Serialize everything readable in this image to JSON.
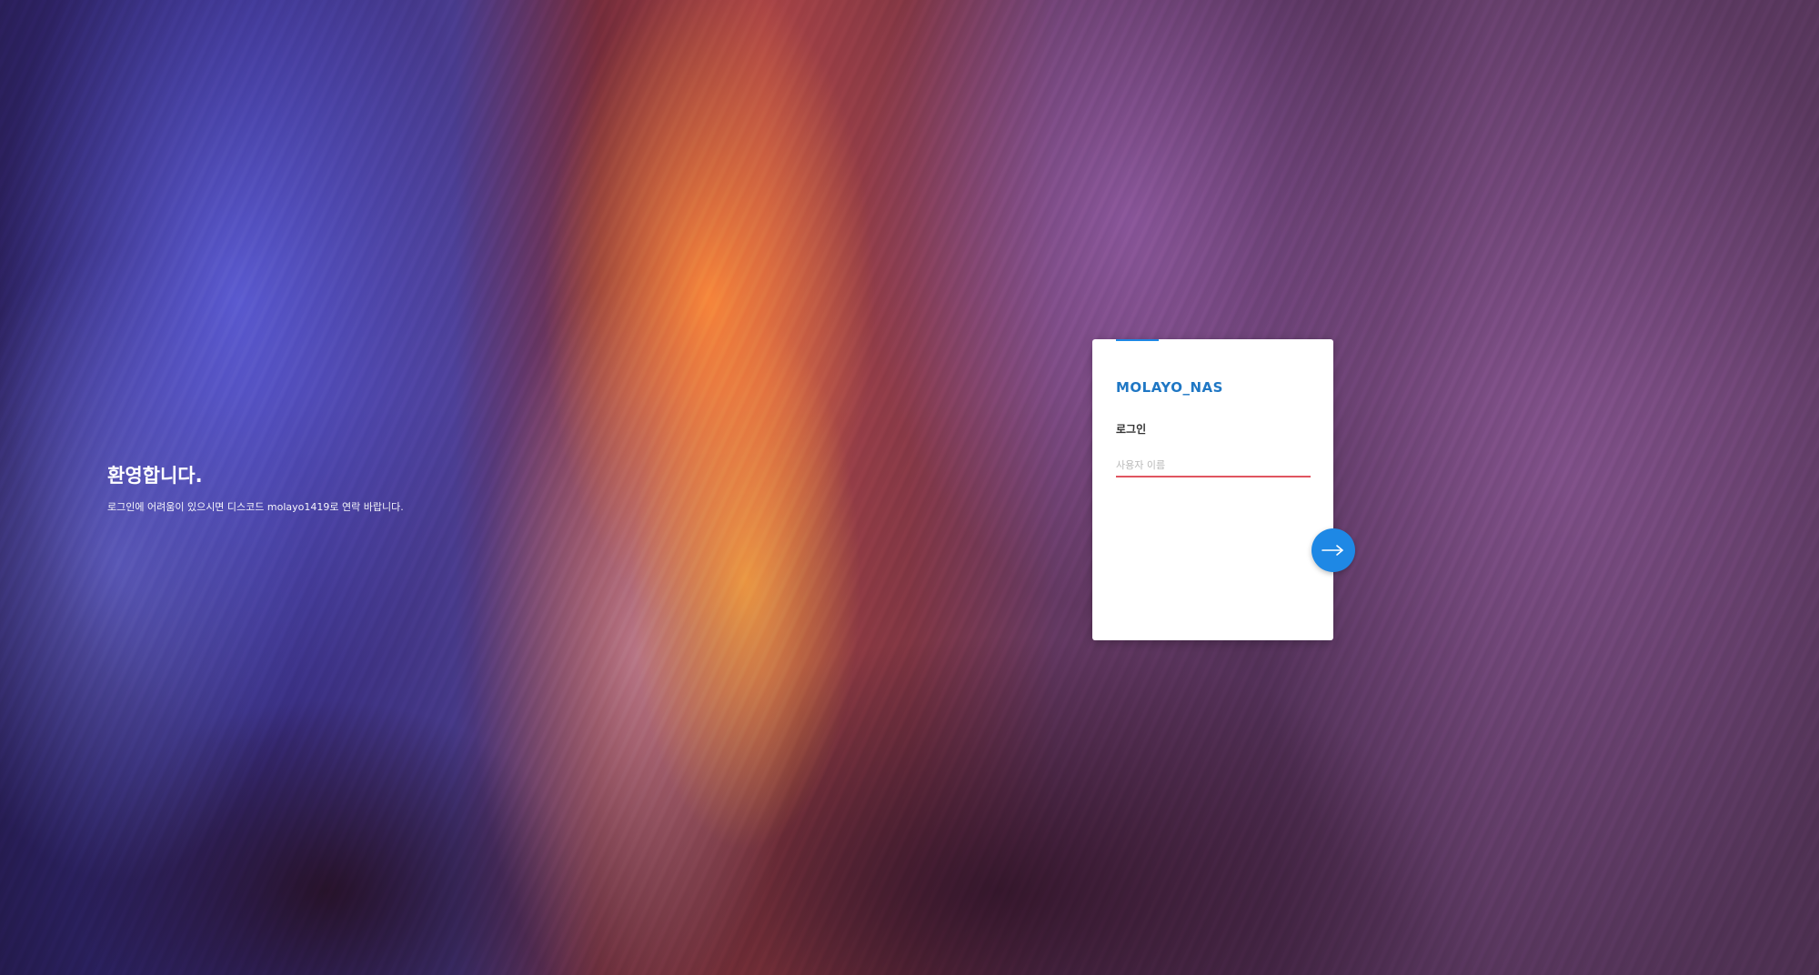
{
  "welcome": {
    "title": "환영합니다.",
    "message": "로그인에 어려움이 있으시면 디스코드 molayo1419로 연락 바랍니다."
  },
  "login_card": {
    "brand": "MOLAYO_NAS",
    "heading": "로그인",
    "username_placeholder": "사용자 이름",
    "username_value": ""
  },
  "colors": {
    "accent": "#1e88e5",
    "brand_text": "#1f77c4",
    "input_underline": "#e05560"
  },
  "icons": {
    "next": "arrow-right-icon"
  }
}
